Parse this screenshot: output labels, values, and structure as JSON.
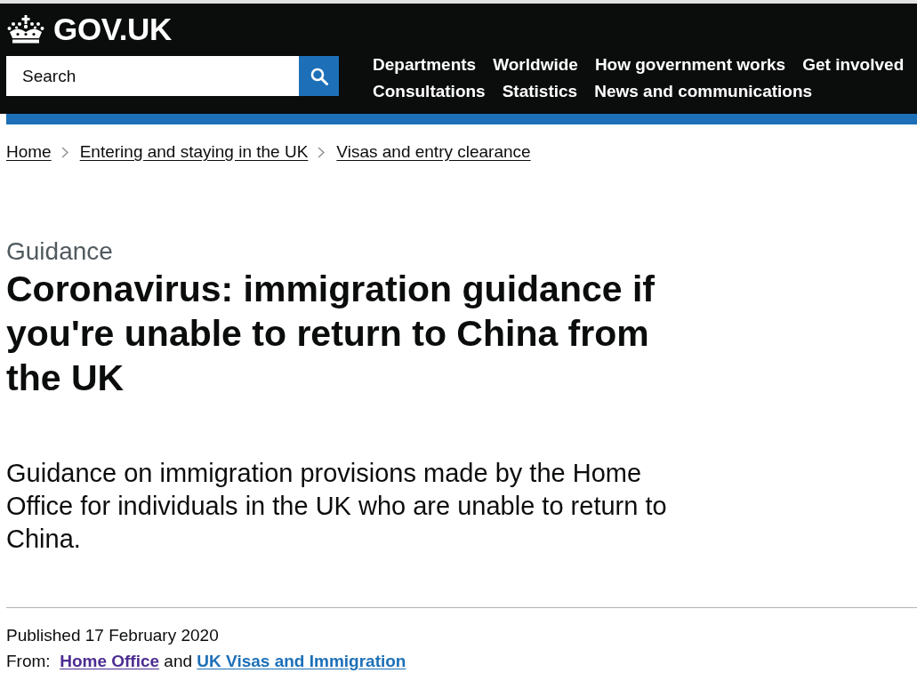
{
  "header": {
    "logo_text": "GOV.UK",
    "search": {
      "placeholder": "Search"
    },
    "nav": [
      {
        "label": "Departments"
      },
      {
        "label": "Worldwide"
      },
      {
        "label": "How government works"
      },
      {
        "label": "Get involved"
      },
      {
        "label": "Consultations"
      },
      {
        "label": "Statistics"
      },
      {
        "label": "News and communications"
      }
    ]
  },
  "breadcrumbs": [
    {
      "label": "Home"
    },
    {
      "label": "Entering and staying in the UK"
    },
    {
      "label": "Visas and entry clearance"
    }
  ],
  "caption": "Guidance",
  "title": "Coronavirus: immigration guidance if you're unable to return to China from the UK",
  "lead": "Guidance on immigration provisions made by the Home Office for individuals in the UK who are unable to return to China.",
  "metadata": {
    "published": "Published 17 February 2020",
    "from": {
      "label": "From:",
      "joiner": "and",
      "organisations": [
        {
          "name": "Home Office",
          "visited": true
        },
        {
          "name": "UK Visas and Immigration",
          "visited": false
        }
      ]
    }
  }
}
